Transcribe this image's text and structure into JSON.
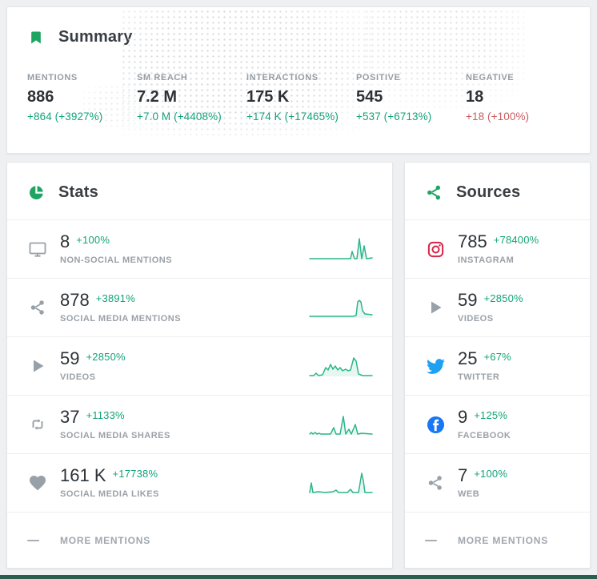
{
  "theme": {
    "accent_green": "#12a378",
    "icon_green": "#1fa562",
    "spark_green": "#2eb58b",
    "negative_red": "#ca5b60",
    "twitter_blue": "#1da1f2",
    "facebook_blue": "#1877f2",
    "bottom_bar_green": "#2c5e50"
  },
  "summary": {
    "title": "Summary",
    "metrics": [
      {
        "label": "MENTIONS",
        "value": "886",
        "change": "+864 (+3927%)",
        "direction": "up"
      },
      {
        "label": "SM REACH",
        "value": "7.2 M",
        "change": "+7.0 M (+4408%)",
        "direction": "up"
      },
      {
        "label": "INTERACTIONS",
        "value": "175 K",
        "change": "+174 K (+17465%)",
        "direction": "up"
      },
      {
        "label": "POSITIVE",
        "value": "545",
        "change": "+537 (+6713%)",
        "direction": "up"
      },
      {
        "label": "NEGATIVE",
        "value": "18",
        "change": "+18 (+100%)",
        "direction": "down"
      }
    ]
  },
  "stats": {
    "title": "Stats",
    "rows": [
      {
        "icon": "monitor-icon",
        "value": "8",
        "change": "+100%",
        "label": "NON-SOCIAL MENTIONS",
        "sparkline": [
          [
            1,
            29
          ],
          [
            48,
            29
          ],
          [
            52,
            29
          ],
          [
            54,
            20
          ],
          [
            57,
            29
          ],
          [
            60,
            29
          ],
          [
            63,
            4
          ],
          [
            66,
            29
          ],
          [
            69,
            13
          ],
          [
            72,
            29
          ],
          [
            79,
            28
          ]
        ]
      },
      {
        "icon": "share-icon",
        "value": "878",
        "change": "+3891%",
        "label": "SOCIAL MEDIA MENTIONS",
        "sparkline": [
          [
            1,
            28
          ],
          [
            55,
            28
          ],
          [
            59,
            27
          ],
          [
            61,
            10
          ],
          [
            63,
            8
          ],
          [
            65,
            10
          ],
          [
            67,
            21
          ],
          [
            70,
            25
          ],
          [
            79,
            26
          ]
        ]
      },
      {
        "icon": "play-icon",
        "value": "59",
        "change": "+2850%",
        "label": "VIDEOS",
        "sparkline": [
          [
            1,
            29
          ],
          [
            6,
            29
          ],
          [
            9,
            26
          ],
          [
            12,
            29
          ],
          [
            17,
            28
          ],
          [
            21,
            19
          ],
          [
            24,
            22
          ],
          [
            27,
            15
          ],
          [
            30,
            21
          ],
          [
            33,
            17
          ],
          [
            36,
            22
          ],
          [
            39,
            19
          ],
          [
            42,
            23
          ],
          [
            46,
            21
          ],
          [
            49,
            23
          ],
          [
            52,
            22
          ],
          [
            56,
            7
          ],
          [
            59,
            11
          ],
          [
            62,
            27
          ],
          [
            67,
            29
          ],
          [
            79,
            29
          ]
        ]
      },
      {
        "icon": "retweet-icon",
        "value": "37",
        "change": "+1133%",
        "label": "SOCIAL MEDIA SHARES",
        "sparkline": [
          [
            1,
            29
          ],
          [
            3,
            27
          ],
          [
            5,
            29
          ],
          [
            8,
            27
          ],
          [
            10,
            29
          ],
          [
            13,
            28
          ],
          [
            15,
            29
          ],
          [
            27,
            29
          ],
          [
            31,
            21
          ],
          [
            34,
            29
          ],
          [
            39,
            29
          ],
          [
            43,
            7
          ],
          [
            46,
            29
          ],
          [
            50,
            23
          ],
          [
            53,
            29
          ],
          [
            58,
            17
          ],
          [
            61,
            29
          ],
          [
            66,
            28
          ],
          [
            79,
            29
          ]
        ]
      },
      {
        "icon": "heart-icon",
        "value": "161 K",
        "change": "+17738%",
        "label": "SOCIAL MEDIA LIKES",
        "sparkline": [
          [
            1,
            29
          ],
          [
            3,
            17
          ],
          [
            5,
            29
          ],
          [
            12,
            28
          ],
          [
            20,
            29
          ],
          [
            30,
            28
          ],
          [
            34,
            26
          ],
          [
            37,
            29
          ],
          [
            48,
            29
          ],
          [
            52,
            25
          ],
          [
            55,
            29
          ],
          [
            62,
            29
          ],
          [
            66,
            5
          ],
          [
            68,
            14
          ],
          [
            70,
            29
          ],
          [
            79,
            29
          ]
        ]
      }
    ],
    "footer": "MORE MENTIONS"
  },
  "sources": {
    "title": "Sources",
    "rows": [
      {
        "icon": "instagram-icon",
        "value": "785",
        "change": "+78400%",
        "label": "INSTAGRAM"
      },
      {
        "icon": "play-icon",
        "value": "59",
        "change": "+2850%",
        "label": "VIDEOS"
      },
      {
        "icon": "twitter-icon",
        "value": "25",
        "change": "+67%",
        "label": "TWITTER"
      },
      {
        "icon": "facebook-icon",
        "value": "9",
        "change": "+125%",
        "label": "FACEBOOK"
      },
      {
        "icon": "share-icon",
        "value": "7",
        "change": "+100%",
        "label": "WEB"
      }
    ],
    "footer": "MORE MENTIONS"
  }
}
